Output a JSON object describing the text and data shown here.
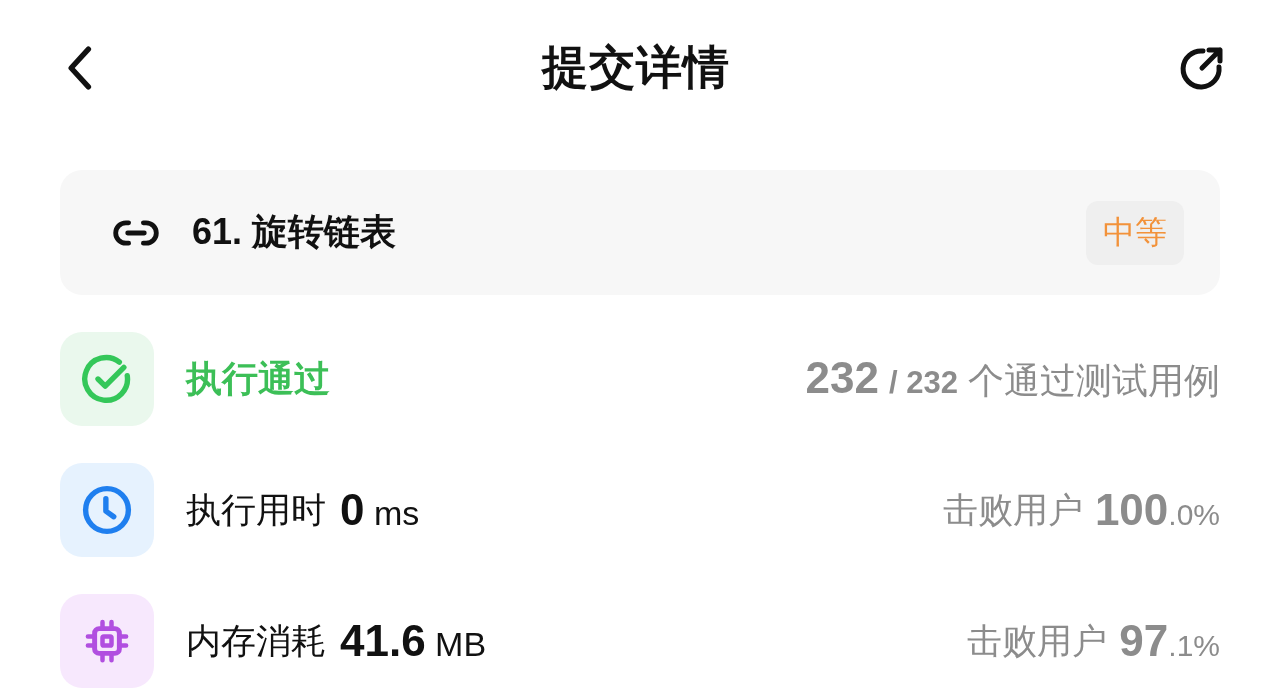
{
  "header": {
    "title": "提交详情"
  },
  "problem": {
    "title": "61. 旋转链表",
    "difficulty": "中等"
  },
  "status": {
    "label": "执行通过",
    "passed": true,
    "passed_count": "232",
    "total": "/ 232",
    "suffix": "个通过测试用例"
  },
  "metrics": [
    {
      "kind": "runtime",
      "label": "执行用时",
      "value": "0",
      "unit": "ms",
      "beat_label": "击败用户",
      "beat_whole": "100",
      "beat_fraction": ".0%"
    },
    {
      "kind": "memory",
      "label": "内存消耗",
      "value": "41.6",
      "unit": "MB",
      "beat_label": "击败用户",
      "beat_whole": "97",
      "beat_fraction": ".1%"
    }
  ]
}
